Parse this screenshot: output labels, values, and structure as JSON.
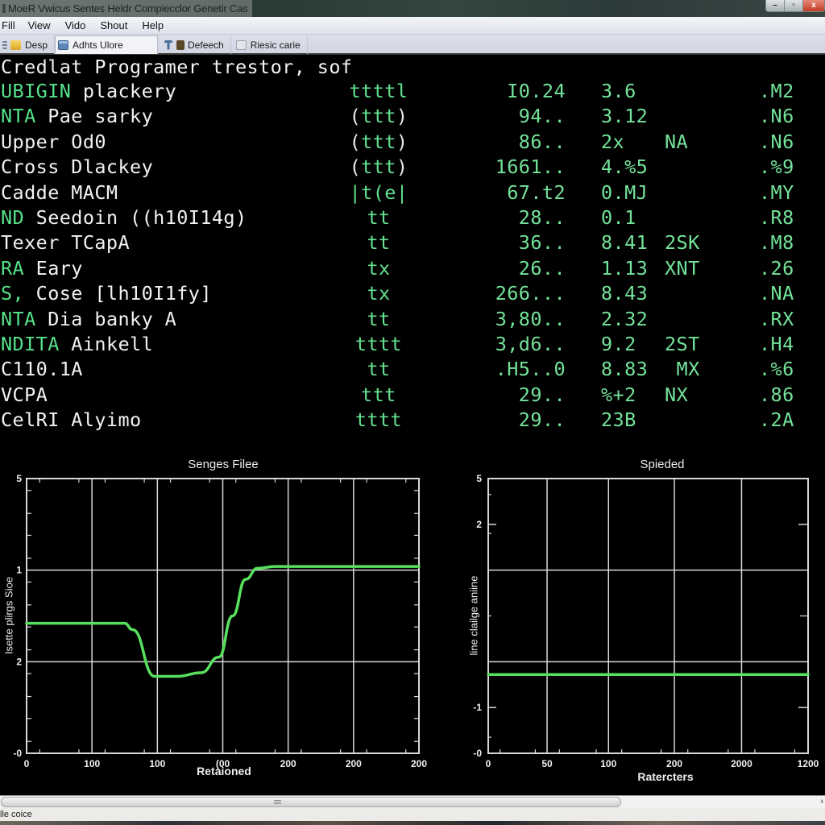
{
  "window": {
    "title": "MoeR Vwicus Sentes Heldr Compiecclor Genetir Cas",
    "controls": {
      "minimize": "–",
      "restore": "▫",
      "close": "x"
    }
  },
  "menu": [
    "Fill",
    "View",
    "Vido",
    "Shout",
    "Help"
  ],
  "toolbar": {
    "items": [
      {
        "label": "Desp",
        "icon": "folder-icon",
        "active": false
      },
      {
        "label": "Adhts Ulore",
        "icon": "window-icon",
        "active": true
      },
      {
        "label": "Defeech",
        "icon": "tools-icon",
        "active": false
      },
      {
        "label": "Riesic carie",
        "icon": "image-icon",
        "active": false
      }
    ]
  },
  "terminal": {
    "header": "Credlat Programer trestor, sof",
    "rows": [
      {
        "prefix": "UBIGIN",
        "name": " plackery",
        "flag": "ttttl",
        "paren": false,
        "value": "I0.24",
        "rate": "3.6",
        "code": "",
        "ext": ".M2"
      },
      {
        "prefix": "NTA",
        "name": " Pae sarky",
        "flag": "ttt",
        "paren": true,
        "value": "94..",
        "rate": "3.12",
        "code": "",
        "ext": ".N6"
      },
      {
        "prefix": "",
        "name": "Upper Od0",
        "flag": "ttt",
        "paren": true,
        "value": "86..",
        "rate": "2x",
        "code": "NA",
        "ext": ".N6"
      },
      {
        "prefix": "",
        "name": "Cross Dlackey",
        "flag": "ttt",
        "paren": true,
        "value": "1661..",
        "rate": "4.%5",
        "code": "",
        "ext": ".%9"
      },
      {
        "prefix": "",
        "name": "Cadde MACM",
        "flag": "|t(e|",
        "paren": false,
        "value": "67.t2",
        "rate": "0.MJ",
        "code": "",
        "ext": ".MY"
      },
      {
        "prefix": "ND",
        "name": " Seedoin ((h10I14g)",
        "flag": "tt",
        "paren": false,
        "value": "28..",
        "rate": "0.1",
        "code": "",
        "ext": ".R8"
      },
      {
        "prefix": "",
        "name": "Texer TCapA",
        "flag": "tt",
        "paren": false,
        "value": "36..",
        "rate": "8.41",
        "code": "2SK",
        "ext": ".M8"
      },
      {
        "prefix": "RA",
        "name": " Eary",
        "flag": "tx",
        "paren": false,
        "value": "26..",
        "rate": "1.13",
        "code": "XNT",
        "ext": ".26"
      },
      {
        "prefix": "S,",
        "name": " Cose [lh10I1fy]",
        "flag": "tx",
        "paren": false,
        "value": "266...",
        "rate": "8.43",
        "code": "",
        "ext": ".NA"
      },
      {
        "prefix": "NTA",
        "name": " Dia banky A",
        "flag": "tt",
        "paren": false,
        "value": "3,80..",
        "rate": "2.32",
        "code": "",
        "ext": ".RX"
      },
      {
        "prefix": "NDITA",
        "name": " Ainkell",
        "flag": "tttt",
        "paren": false,
        "value": "3,d6..",
        "rate": "9.2",
        "code": "2ST",
        "ext": ".H4"
      },
      {
        "prefix": "",
        "name": "C110.1A",
        "flag": "tt",
        "paren": false,
        "value": ".H5..0",
        "rate": "8.83",
        "code": " MX",
        "ext": ".%6"
      },
      {
        "prefix": "",
        "name": "VCPA",
        "flag": "ttt",
        "paren": false,
        "value": "29..",
        "rate": "%+2",
        "code": "NX",
        "ext": ".86"
      },
      {
        "prefix": "",
        "name": "CelRI Alyimo",
        "flag": "tttt",
        "paren": false,
        "value": "29..",
        "rate": "23B",
        "code": "",
        "ext": ".2A"
      }
    ]
  },
  "colors": {
    "terminal_bg": "#000000",
    "terminal_green": "#74e39a",
    "curve_green": "#57e05d",
    "grid": "#d8d8d8"
  },
  "chart_data": [
    {
      "type": "line",
      "title": "Senges Filee",
      "xlabel": "Retaioned",
      "ylabel": "Isette plirgs Sioe",
      "x_tick_labels": [
        "0",
        "100",
        "100",
        "(00",
        "200",
        "200",
        "200"
      ],
      "y_tick_labels": [
        "-0",
        "2",
        "1",
        "5"
      ],
      "x_range_index": [
        0,
        6
      ],
      "y_range_index": [
        0,
        3
      ],
      "grid": true,
      "note": "Axis tick labels are non-monotonic; series values are expressed in tick-index units (x: 0..6 across labelled ticks, y: 0..3 across labelled ticks).",
      "series": [
        {
          "name": "curve",
          "color": "#57e05d",
          "x": [
            0,
            1.0,
            1.5,
            1.62,
            1.96,
            2.3,
            2.67,
            2.94,
            3.15,
            3.35,
            3.53,
            3.8,
            4.5,
            6.0
          ],
          "y": [
            1.42,
            1.42,
            1.42,
            1.35,
            0.84,
            0.84,
            0.88,
            1.05,
            1.5,
            1.9,
            2.02,
            2.04,
            2.04,
            2.04
          ]
        }
      ]
    },
    {
      "type": "line",
      "title": "Spieded",
      "xlabel": "Ratercters",
      "ylabel": "line clailge aniine",
      "x_tick_labels": [
        "0",
        "50",
        "100",
        "200",
        "2000",
        "1200"
      ],
      "x_tick_index": [
        0,
        0.92,
        1.88,
        2.91,
        3.96,
        5
      ],
      "y_tick_labels": [
        {
          "label": "-0",
          "index": 0
        },
        {
          "label": "-1",
          "index": 1
        },
        {
          "label": "2",
          "index": 5
        },
        {
          "label": "5",
          "index": 6
        }
      ],
      "x_range_index": [
        0,
        5
      ],
      "y_range_index": [
        0,
        6
      ],
      "grid": true,
      "series": [
        {
          "name": "flat-line",
          "color": "#57e05d",
          "x": [
            0,
            5
          ],
          "y": [
            1.72,
            1.72
          ]
        }
      ]
    }
  ],
  "scrollbar": {
    "position_fraction": 0.0,
    "visible_fraction": 0.75
  },
  "status": {
    "text": "lle coice"
  }
}
